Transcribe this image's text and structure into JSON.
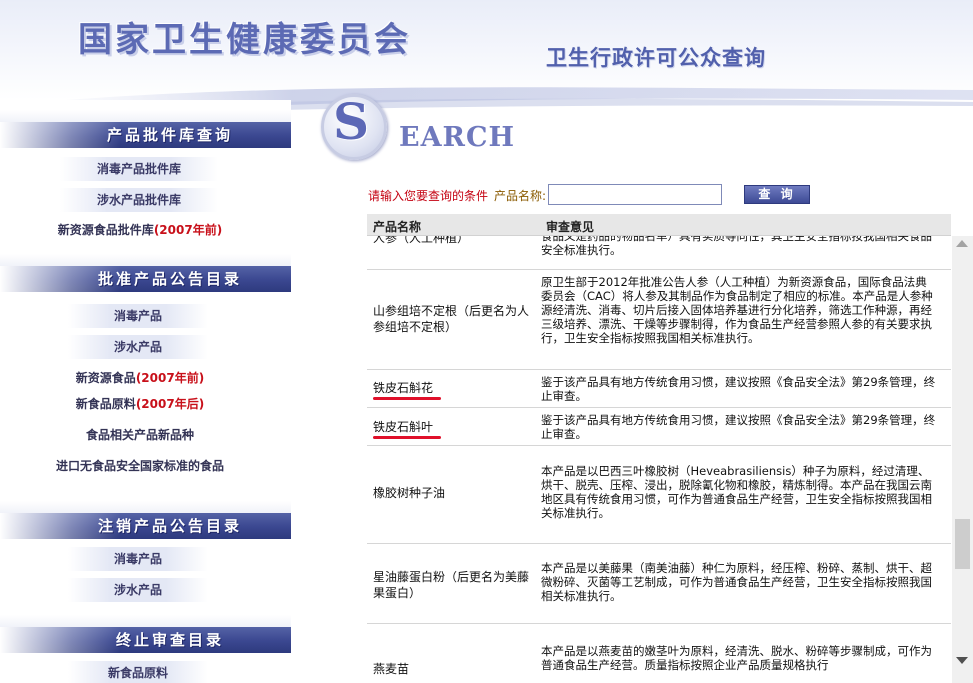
{
  "header": {
    "org_title": "国家卫生健康委员会",
    "sub_title": "卫生行政许可公众查询"
  },
  "sidebar": {
    "sections": [
      {
        "title": "产品批件库查询",
        "items": [
          {
            "label": "消毒产品批件库"
          },
          {
            "label": "涉水产品批件库"
          },
          {
            "label": "新资源食品批件库",
            "note": "(2007年前)"
          }
        ]
      },
      {
        "title": "批准产品公告目录",
        "items": [
          {
            "label": "消毒产品"
          },
          {
            "label": "涉水产品"
          },
          {
            "label": "新资源食品",
            "note": "(2007年前)"
          },
          {
            "label": "新食品原料",
            "note": "(2007年后)"
          },
          {
            "label": "食品相关产品新品种"
          },
          {
            "label": "进口无食品安全国家标准的食品"
          }
        ]
      },
      {
        "title": "注销产品公告目录",
        "items": [
          {
            "label": "消毒产品"
          },
          {
            "label": "涉水产品"
          }
        ]
      },
      {
        "title": "终止审查目录",
        "items": [
          {
            "label": "新食品原料"
          }
        ]
      }
    ]
  },
  "search": {
    "logo_letter": "S",
    "logo_word": "EARCH",
    "prompt": "请输入您要查询的条件",
    "name_label": "产品名称:",
    "name_value": "",
    "query_button": "查 询"
  },
  "table": {
    "headers": {
      "name": "产品名称",
      "opinion": "审查意见"
    },
    "rows": [
      {
        "name": "人参（人工种植）",
        "opinion": "食品义是药品的物品名单）具有实质等同性，其卫生安全指标按我国相关食品安全标准执行。"
      },
      {
        "name": "山参组培不定根（后更名为人参组培不定根）",
        "opinion": "原卫生部于2012年批准公告人参（人工种植）为新资源食品，国际食品法典委员会（CAC）将人参及其制品作为食品制定了相应的标准。本产品是人参种源经清洗、消毒、切片后接入固体培养基进行分化培养，筛选工作种源，再经三级培养、漂洗、干燥等步骤制得，作为食品生产经营参照人参的有关要求执行，卫生安全指标按照我国相关标准执行。"
      },
      {
        "name": "铁皮石斛花",
        "opinion": "鉴于该产品具有地方传统食用习惯，建议按照《食品安全法》第29条管理，终止审查。"
      },
      {
        "name": "铁皮石斛叶",
        "opinion": "鉴于该产品具有地方传统食用习惯，建议按照《食品安全法》第29条管理，终止审查。"
      },
      {
        "name": "橡胶树种子油",
        "opinion": "本产品是以巴西三叶橡胶树（Heveabrasiliensis）种子为原料，经过清理、烘干、脱壳、压榨、浸出，脱除氰化物和橡胶，精炼制得。本产品在我国云南地区具有传统食用习惯，可作为普通食品生产经营，卫生安全指标按照我国相关标准执行。"
      },
      {
        "name": "星油藤蛋白粉（后更名为美藤果蛋白）",
        "opinion": "本产品是以美藤果（南美油藤）种仁为原料，经压榨、粉碎、蒸制、烘干、超微粉碎、灭菌等工艺制成，可作为普通食品生产经营，卫生安全指标按照我国相关标准执行。"
      },
      {
        "name": "燕麦苗",
        "opinion": "本产品是以燕麦苗的嫩茎叶为原料，经清洗、脱水、粉碎等步骤制成，可作为普通食品生产经营。质量指标按照企业产品质量规格执行"
      }
    ]
  }
}
